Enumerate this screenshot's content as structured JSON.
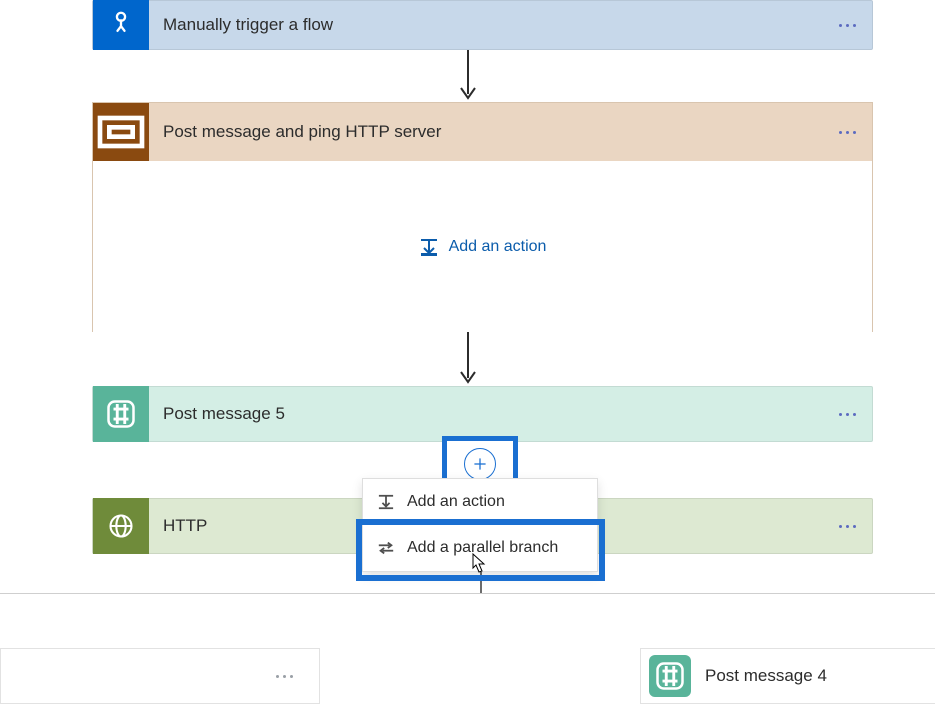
{
  "colors": {
    "highlight": "#1a6fd1",
    "trigger": "#0066cc",
    "scope": "#8a4a10",
    "post": "#59b49a",
    "http": "#6f8b3a"
  },
  "trigger": {
    "title": "Manually trigger a flow"
  },
  "scope": {
    "title": "Post message and ping HTTP server",
    "add_action_label": "Add an action"
  },
  "post5": {
    "title": "Post message 5"
  },
  "http": {
    "title": "HTTP"
  },
  "add_menu": {
    "add_action": "Add an action",
    "add_parallel": "Add a parallel branch"
  },
  "bottom": {
    "post4_title": "Post message 4"
  }
}
